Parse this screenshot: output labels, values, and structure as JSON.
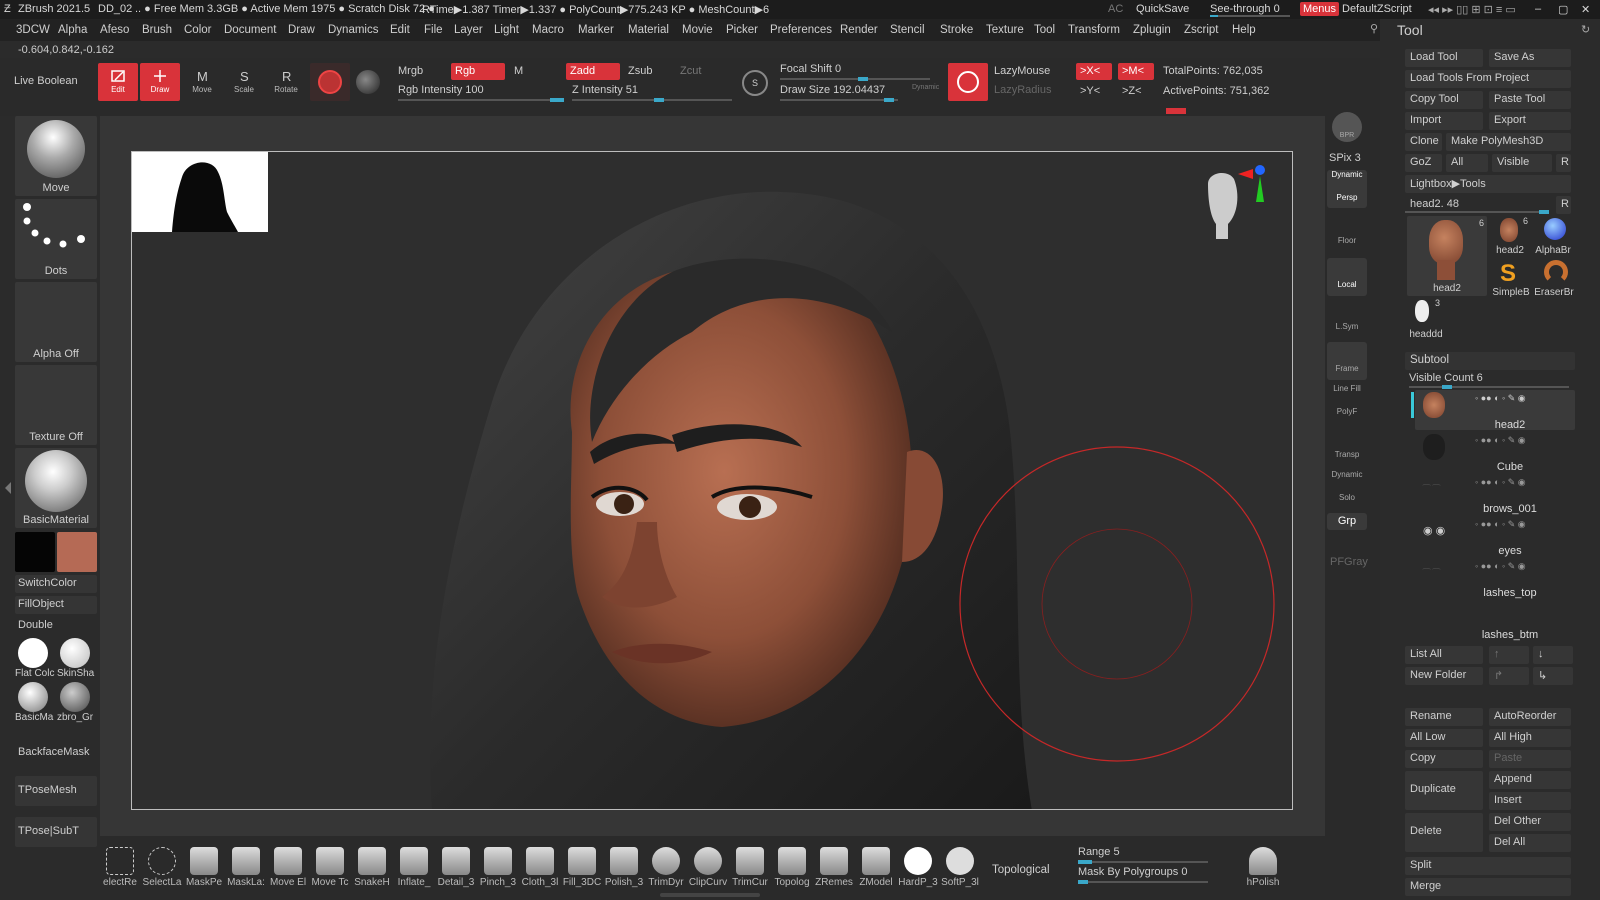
{
  "titlebar": {
    "app": "ZBrush 2021.5",
    "doc": "DD_02",
    "free_mem": ".. ● Free Mem 3.3GB ● Active Mem 1975 ● Scratch Disk 72 ●",
    "rtime": "RTime▶1.387 Timer▶1.337 ● PolyCount▶775.243 KP ● MeshCount▶6",
    "ac": "AC",
    "quicksave": "QuickSave",
    "seethrough": "See-through 0",
    "menus": "Menus",
    "defaultzscript": "DefaultZScript"
  },
  "menubar": [
    "3DCW",
    "Alpha",
    "Afeso",
    "Brush",
    "Color",
    "Document",
    "Draw",
    "Dynamics",
    "Edit",
    "File",
    "Layer",
    "Light",
    "Macro",
    "Marker",
    "Material",
    "Movie",
    "Picker",
    "Preferences",
    "Render",
    "Stencil",
    "Stroke",
    "Texture",
    "Tool",
    "Transform",
    "Zplugin",
    "Zscript",
    "Help"
  ],
  "coords": "-0.604,0.842,-0.162",
  "topshelf": {
    "live_boolean": "Live Boolean",
    "edit": "Edit",
    "draw": "Draw",
    "move": "Move",
    "scale": "Scale",
    "rotate": "Rotate",
    "mrgb": "Mrgb",
    "rgb": "Rgb",
    "m": "M",
    "rgb_intensity": "Rgb Intensity 100",
    "rgb_intensity_value": 100,
    "zadd": "Zadd",
    "zsub": "Zsub",
    "zcut": "Zcut",
    "z_intensity": "Z Intensity 51",
    "z_intensity_value": 51,
    "focal_shift": "Focal Shift 0",
    "draw_size": "Draw Size 192.04437",
    "dynamic": "Dynamic",
    "lazymouse": "LazyMouse",
    "lazyradius": "LazyRadius",
    "x_sym": ">X<",
    "m_sym": ">M<",
    "y_sym": ">Y<",
    "z_sym": ">Z<",
    "total_points": "TotalPoints: 762,035",
    "active_points": "ActivePoints: 751,362"
  },
  "leftpanel": {
    "move": "Move",
    "dots": "Dots",
    "alpha_off": "Alpha Off",
    "texture_off": "Texture Off",
    "basic_material": "BasicMaterial",
    "switch_color": "SwitchColor",
    "fill_object": "FillObject",
    "double": "Double",
    "mat1": "Flat Colc",
    "mat2": "SkinSha",
    "mat3": "BasicMa",
    "mat4": "zbro_Gr",
    "backface": "BackfaceMask",
    "tposemesh": "TPoseMesh",
    "tposesubt": "TPose|SubT",
    "main_color": "#b56a55"
  },
  "rightstrip": {
    "bpr": "BPR",
    "spix": "SPix 3",
    "dynamic": "Dynamic",
    "persp": "Persp",
    "floor": "Floor",
    "local": "Local",
    "lsym": "L.Sym",
    "frame": "Frame",
    "linefill": "Line Fill",
    "polyf": "PolyF",
    "transp": "Transp",
    "dynamic2": "Dynamic",
    "solo": "Solo",
    "grp": "Grp",
    "pfgray": "PFGray"
  },
  "tool": {
    "title": "Tool",
    "load_tool": "Load Tool",
    "save_as": "Save As",
    "load_from_project": "Load Tools From Project",
    "copy_tool": "Copy Tool",
    "paste_tool": "Paste Tool",
    "import": "Import",
    "export": "Export",
    "clone": "Clone",
    "make_polymesh": "Make PolyMesh3D",
    "goz": "GoZ",
    "all": "All",
    "visible": "Visible",
    "r": "R",
    "lightbox": "Lightbox▶Tools",
    "head2_slider": "head2. 48",
    "r2": "R",
    "thumbs": [
      {
        "name": "head2",
        "count": "6"
      },
      {
        "name": "head2",
        "count": "6"
      },
      {
        "name": "AlphaBr",
        "count": ""
      },
      {
        "name": "SimpleB",
        "count": ""
      },
      {
        "name": "EraserBr",
        "count": ""
      },
      {
        "name": "headdd",
        "count": "3"
      }
    ]
  },
  "subtool": {
    "title": "Subtool",
    "visible_count": "Visible Count 6",
    "items": [
      "head2",
      "Cube",
      "brows_001",
      "eyes",
      "lashes_top",
      "lashes_btm"
    ],
    "list_all": "List All",
    "new_folder": "New Folder",
    "rename": "Rename",
    "autoreorder": "AutoReorder",
    "all_low": "All Low",
    "all_high": "All High",
    "copy": "Copy",
    "paste": "Paste",
    "duplicate": "Duplicate",
    "append": "Append",
    "insert": "Insert",
    "delete": "Delete",
    "del_other": "Del Other",
    "del_all": "Del All",
    "split": "Split",
    "merge": "Merge"
  },
  "bottomshelf": {
    "items": [
      "electRe",
      "SelectLa",
      "MaskPe",
      "MaskLa:",
      "Move El",
      "Move Tc",
      "SnakeH",
      "Inflate_",
      "Detail_3",
      "Pinch_3",
      "Cloth_3l",
      "Fill_3DC",
      "Polish_3",
      "TrimDyr",
      "ClipCurv",
      "TrimCur",
      "Topolog",
      "ZRemes",
      "ZModel",
      "HardP_3",
      "SoftP_3l"
    ],
    "topological": "Topological",
    "range": "Range 5",
    "mask_by_polygroups": "Mask By Polygroups 0",
    "hpolish": "hPolish"
  }
}
